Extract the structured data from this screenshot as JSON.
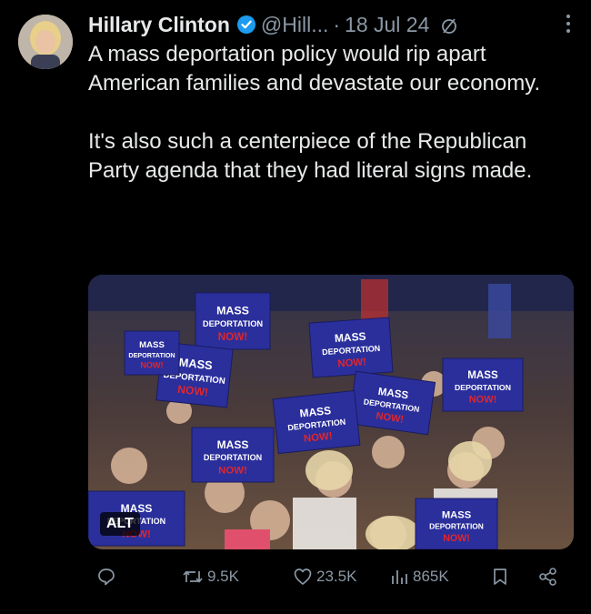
{
  "tweet": {
    "author_name": "Hillary Clinton",
    "handle": "@Hill...",
    "separator": "·",
    "date": "18 Jul 24",
    "text": "A mass deportation policy would rip apart American families and devastate our economy.\n\nIt's also such a centerpiece of the Republican Party agenda that they had literal signs made.",
    "media": {
      "alt_badge": "ALT",
      "sign_lines": [
        "MASS",
        "DEPORTATION",
        "NOW!"
      ]
    }
  },
  "actions": {
    "reply_count": "",
    "retweet_count": "9.5K",
    "like_count": "23.5K",
    "view_count": "865K"
  },
  "colors": {
    "background": "#000000",
    "text": "#e7e9ea",
    "muted": "#8b98a5",
    "verified": "#1d9bf0",
    "sign_blue": "#2b2f9c",
    "sign_red": "#e0262c"
  }
}
